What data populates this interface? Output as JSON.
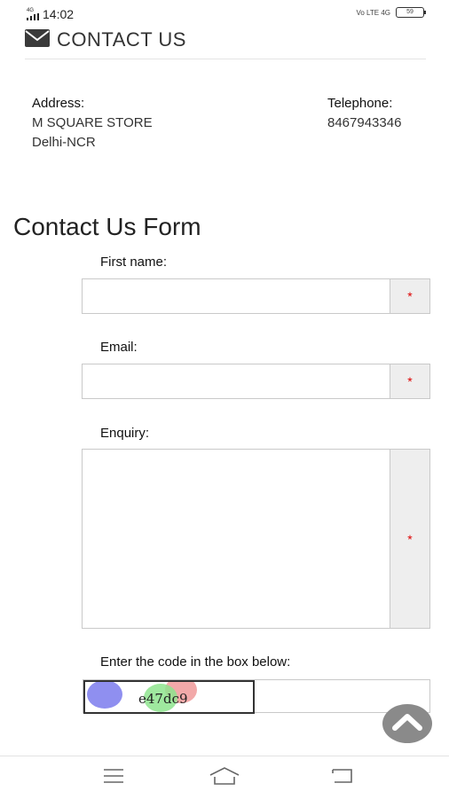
{
  "status_bar": {
    "network": "4G",
    "time": "14:02",
    "right_indicators": "Vo LTE 4G",
    "battery": "59"
  },
  "header": {
    "icon": "envelope-icon",
    "title": "CONTACT US"
  },
  "contact_info": {
    "address_label": "Address:",
    "address_line1": "M SQUARE STORE",
    "address_line2": "Delhi-NCR",
    "telephone_label": "Telephone:",
    "telephone_value": "8467943346"
  },
  "form": {
    "title": "Contact Us Form",
    "first_name_label": "First name:",
    "email_label": "Email:",
    "enquiry_label": "Enquiry:",
    "required_marker": "*",
    "captcha_label": "Enter the code in the box below:",
    "captcha_code": "e47dc9"
  },
  "colors": {
    "required": "#dd0000",
    "scroll_button": "#8a8a8a"
  },
  "nav": {
    "menu_icon": "menu-icon",
    "home_icon": "home-icon",
    "back_icon": "back-icon",
    "scroll_icon": "chevron-up-icon"
  }
}
